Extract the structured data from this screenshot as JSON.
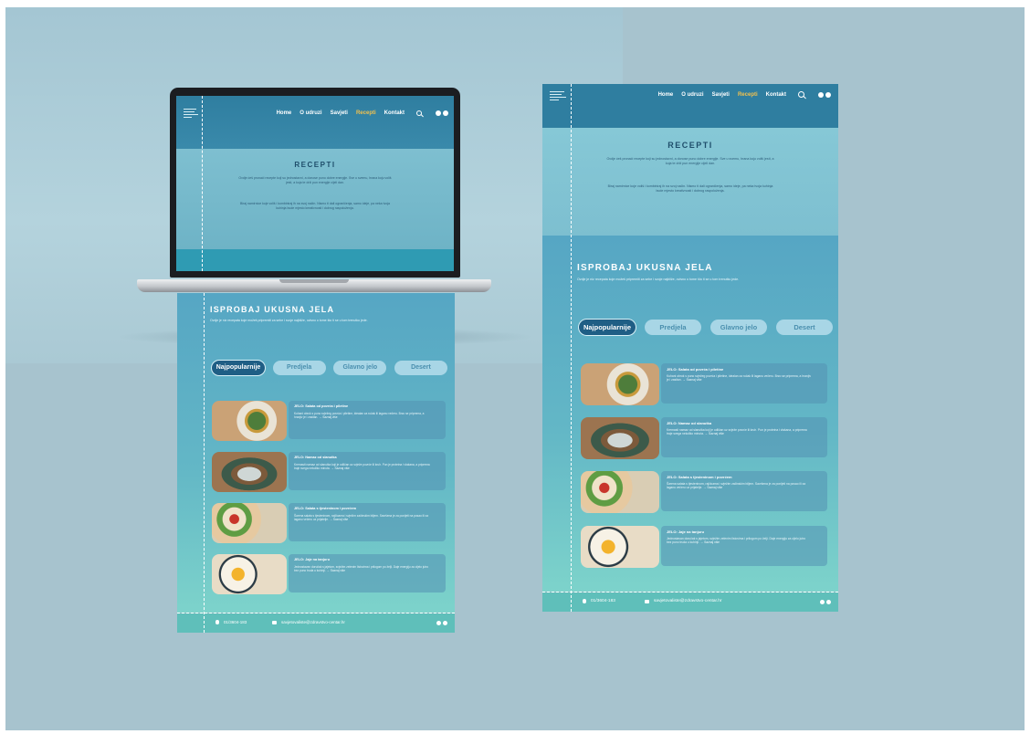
{
  "site": {
    "nav": {
      "links": [
        "Home",
        "O udruzi",
        "Savjeti",
        "Recepti",
        "Kontakt"
      ],
      "active": "Recepti"
    },
    "hero": {
      "title": "RECEPTI",
      "paragraph1": "Ovdje ćeš pronaći recepte koji su jednostavni, a donose puno dobre energije. Sve u svemu, hrana koju voliš jesti, a koja te drži pun energije cijeli dan.",
      "paragraph2": "Biraj namirnice koje voliš i kombiniraj ih na svoj način. Nismo ti dali ograničenja, samo ideje, pa neka tvoja kuhinja bude mjesto kreativnosti i dobrog raspoloženja."
    },
    "menu": {
      "title": "ISPROBAJ UKUSNA JELA",
      "subtitle": "Ovdje je niz recepata koje možeš pripremiti za sebe i svoje najbliže, ovisno o tome što ti se u tom trenutku jede.",
      "tabs": [
        "Najpopularnije",
        "Predjela",
        "Glavno jelo",
        "Desert"
      ],
      "active_tab": "Najpopularnije",
      "cards": [
        {
          "title": "JELO: Salata od povrća i piletine",
          "desc": "Kuhani obrok s puno svježeg povrća i piletine, idealan za ručak ili laganu večeru. Brzo se priprema, a hranjiv je i zasitan.",
          "more": "Saznaj više"
        },
        {
          "title": "JELO: Namaz od slanutka",
          "desc": "Kremasti namaz od slanutka koji je odličan uz svježe povrće ili kruh. Pun je proteina i vlakana, a priprema traje svega nekoliko minuta.",
          "more": "Saznaj više"
        },
        {
          "title": "JELO: Salata s tjesteninom i povrćem",
          "desc": "Šarena salata s tjesteninom, rajčicama i svježim začinskim biljem. Savršena je za ponijeti na posao ili za laganu večeru uz prijatelje.",
          "more": "Saznaj više"
        },
        {
          "title": "JELO: Jaje na tanjuru",
          "desc": "Jednostavan doručak s jajetom, svježim zelenim listovima i prilogom po želji. Daje energiju za cijelo jutro bez puno truda u kuhinji.",
          "more": "Saznaj više"
        }
      ]
    },
    "footer": {
      "phone": "01/3604-183",
      "email": "savjetovaliste@zdravstvo-centar.hr"
    }
  },
  "icons": {
    "search": "search-icon",
    "facebook": "facebook-icon",
    "instagram": "instagram-icon",
    "phone": "phone-icon",
    "mail": "mail-icon",
    "logo": "logo-icon"
  },
  "colors": {
    "nav": "#2f7ea0",
    "accent": "#f2c14e",
    "active_tab": "#1f5e85",
    "footer": "#5fbfba",
    "canvas": "#a7c3ce"
  }
}
